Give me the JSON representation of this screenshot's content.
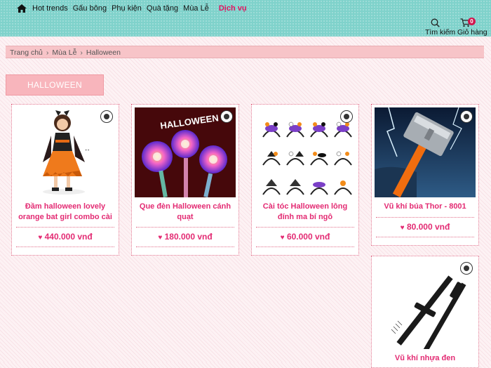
{
  "nav": {
    "items": [
      "Hot trends",
      "Gấu bông",
      "Phụ kiện",
      "Quà tặng",
      "Mùa Lễ"
    ],
    "highlight": "Dịch vụ"
  },
  "header_tools": {
    "search": "Tìm kiếm",
    "cart": "Giỏ hàng",
    "cart_count": "0"
  },
  "breadcrumb": [
    "Trang chủ",
    "Mùa Lễ",
    "Halloween"
  ],
  "category_title": "HALLOWEEN",
  "colors": {
    "accent": "#e32b73",
    "topbar": "#7fd2cb",
    "badge": "#d0164e"
  },
  "products": [
    {
      "name": "Đầm halloween lovely orange bat girl combo cài",
      "price": "440.000 vnđ",
      "image": "girl-orange-dress"
    },
    {
      "name": "Que đèn Halloween cánh quạt",
      "price": "180.000 vnđ",
      "image": "light-wands"
    },
    {
      "name": "Cài tóc Halloween lông đính ma bí ngô",
      "price": "60.000 vnđ",
      "image": "headbands-grid"
    },
    {
      "name": "Vũ khí búa Thor - 8001",
      "price": "80.000 vnđ",
      "image": "thor-hammer"
    },
    {
      "name": "Vũ khí nhựa đen",
      "price": "",
      "image": "black-baton"
    }
  ]
}
